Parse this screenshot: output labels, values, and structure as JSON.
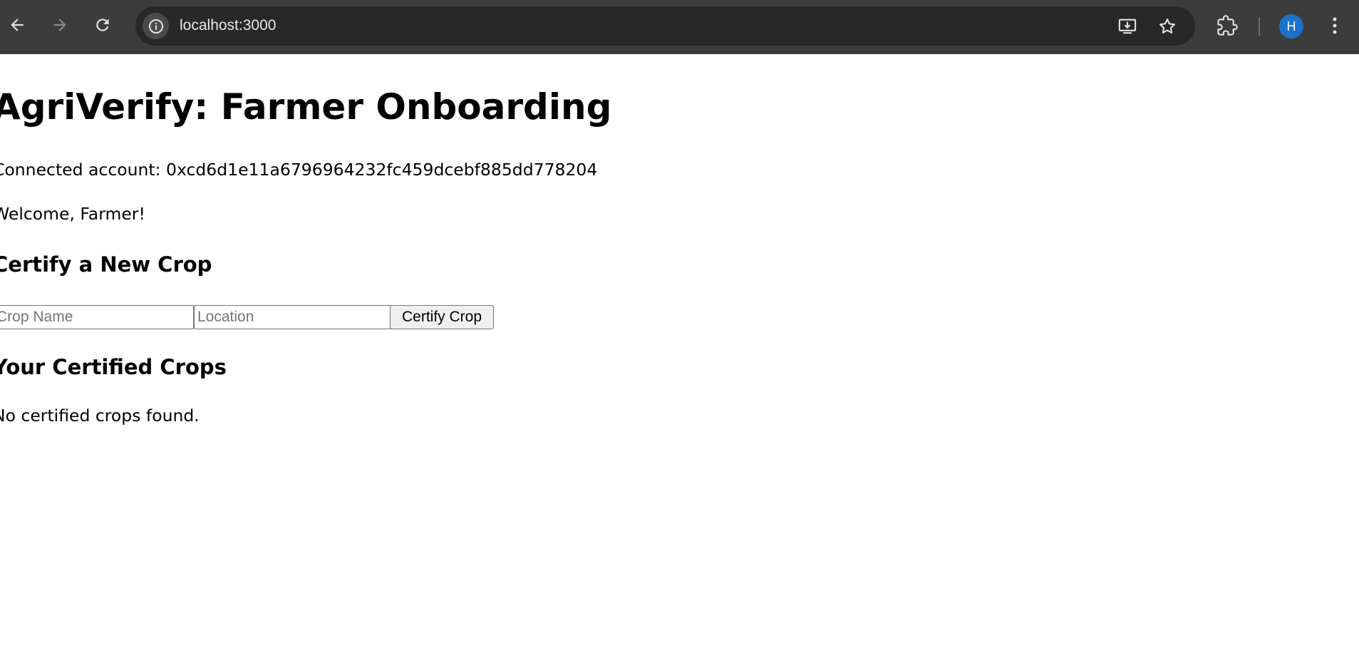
{
  "browser": {
    "url": "localhost:3000",
    "profile_initial": "H",
    "icons": {
      "back": "back-arrow-icon",
      "forward": "forward-arrow-icon",
      "reload": "reload-icon",
      "site_info": "info-icon",
      "install": "install-app-icon",
      "bookmark": "star-icon",
      "extensions": "puzzle-icon",
      "menu": "kebab-menu-icon"
    },
    "colors": {
      "toolbar": "#3c3c3c",
      "omnibox": "#282828",
      "avatar": "#1a73c9"
    }
  },
  "page": {
    "title": "AgriVerify: Farmer Onboarding",
    "connected_account": "Connected account: 0xcd6d1e11a6796964232fc459dcebf885dd778204",
    "welcome": "Welcome, Farmer!",
    "certify_section": {
      "heading": "Certify a New Crop",
      "crop_name_placeholder": "Crop Name",
      "crop_name_value": "",
      "location_placeholder": "Location",
      "location_value": "",
      "submit_label": "Certify Crop"
    },
    "certified_section": {
      "heading": "Your Certified Crops",
      "empty_message": "No certified crops found."
    }
  }
}
